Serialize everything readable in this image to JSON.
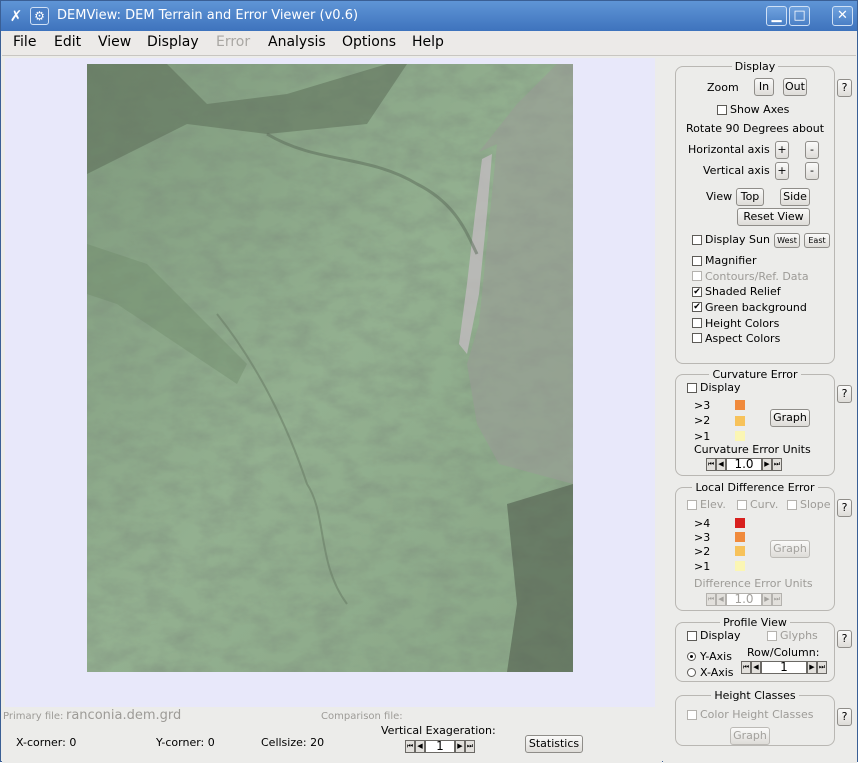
{
  "window": {
    "title": "DEMView: DEM Terrain and Error Viewer (v0.6)",
    "minimize": "▁",
    "maximize": "□",
    "close": "✕",
    "app_icon": "tools-icon",
    "settings_icon": "gear-icon"
  },
  "menu": [
    "File",
    "Edit",
    "View",
    "Display",
    "Error",
    "Analysis",
    "Options",
    "Help"
  ],
  "display_panel": {
    "legend": "Display",
    "zoom_label": "Zoom",
    "zoom_in": "In",
    "zoom_out": "Out",
    "show_axes": "Show Axes",
    "show_axes_checked": false,
    "rotate_label": "Rotate 90 Degrees about",
    "horizontal_axis": "Horizontal axis",
    "vertical_axis": "Vertical axis",
    "plus": "+",
    "minus": "-",
    "view_label": "View",
    "top": "Top",
    "side": "Side",
    "reset_view": "Reset View",
    "display_sun": "Display Sun",
    "west": "West",
    "east": "East",
    "magnifier": "Magnifier",
    "contours": "Contours/Ref. Data",
    "shaded_relief": "Shaded Relief",
    "shaded_relief_checked": true,
    "green_background": "Green background",
    "green_background_checked": true,
    "height_colors": "Height Colors",
    "aspect_colors": "Aspect Colors",
    "help": "?"
  },
  "curvature": {
    "legend": "Curvature Error",
    "display": "Display",
    "thresholds": [
      ">3",
      ">2",
      ">1"
    ],
    "colors": [
      "#f08a3c",
      "#f7c25a",
      "#fbf6b4"
    ],
    "graph": "Graph",
    "units_label": "Curvature Error Units",
    "units_value": "1.0",
    "help": "?"
  },
  "local_diff": {
    "legend": "Local Difference Error",
    "elev": "Elev.",
    "curv": "Curv.",
    "slope": "Slope",
    "thresholds": [
      ">4",
      ">3",
      ">2",
      ">1"
    ],
    "colors": [
      "#d8201e",
      "#f08a3c",
      "#f7c25a",
      "#fbf6b4"
    ],
    "graph": "Graph",
    "units_label": "Difference Error Units",
    "units_value": "1.0",
    "help": "?"
  },
  "profile": {
    "legend": "Profile View",
    "display": "Display",
    "glyphs": "Glyphs",
    "y_axis": "Y-Axis",
    "x_axis": "X-Axis",
    "y_axis_selected": true,
    "rowcol_label": "Row/Column:",
    "rowcol_value": "1",
    "help": "?"
  },
  "height_classes": {
    "legend": "Height Classes",
    "color_height_classes": "Color Height Classes",
    "graph": "Graph",
    "help": "?"
  },
  "status": {
    "primary_label": "Primary file:",
    "primary_value": "ranconia.dem.grd",
    "comparison_label": "Comparison file:",
    "comparison_value": "",
    "xcorner": "X-corner: 0",
    "ycorner": "Y-corner: 0",
    "cellsize": "Cellsize: 20",
    "vert_exag_label": "Vertical Exageration:",
    "vert_exag_value": "1",
    "statistics": "Statistics"
  },
  "terrain": {
    "base_color": "#8fac8c",
    "ridge_color": "#b4b0b2",
    "shadow_color": "#4f5a4b"
  }
}
